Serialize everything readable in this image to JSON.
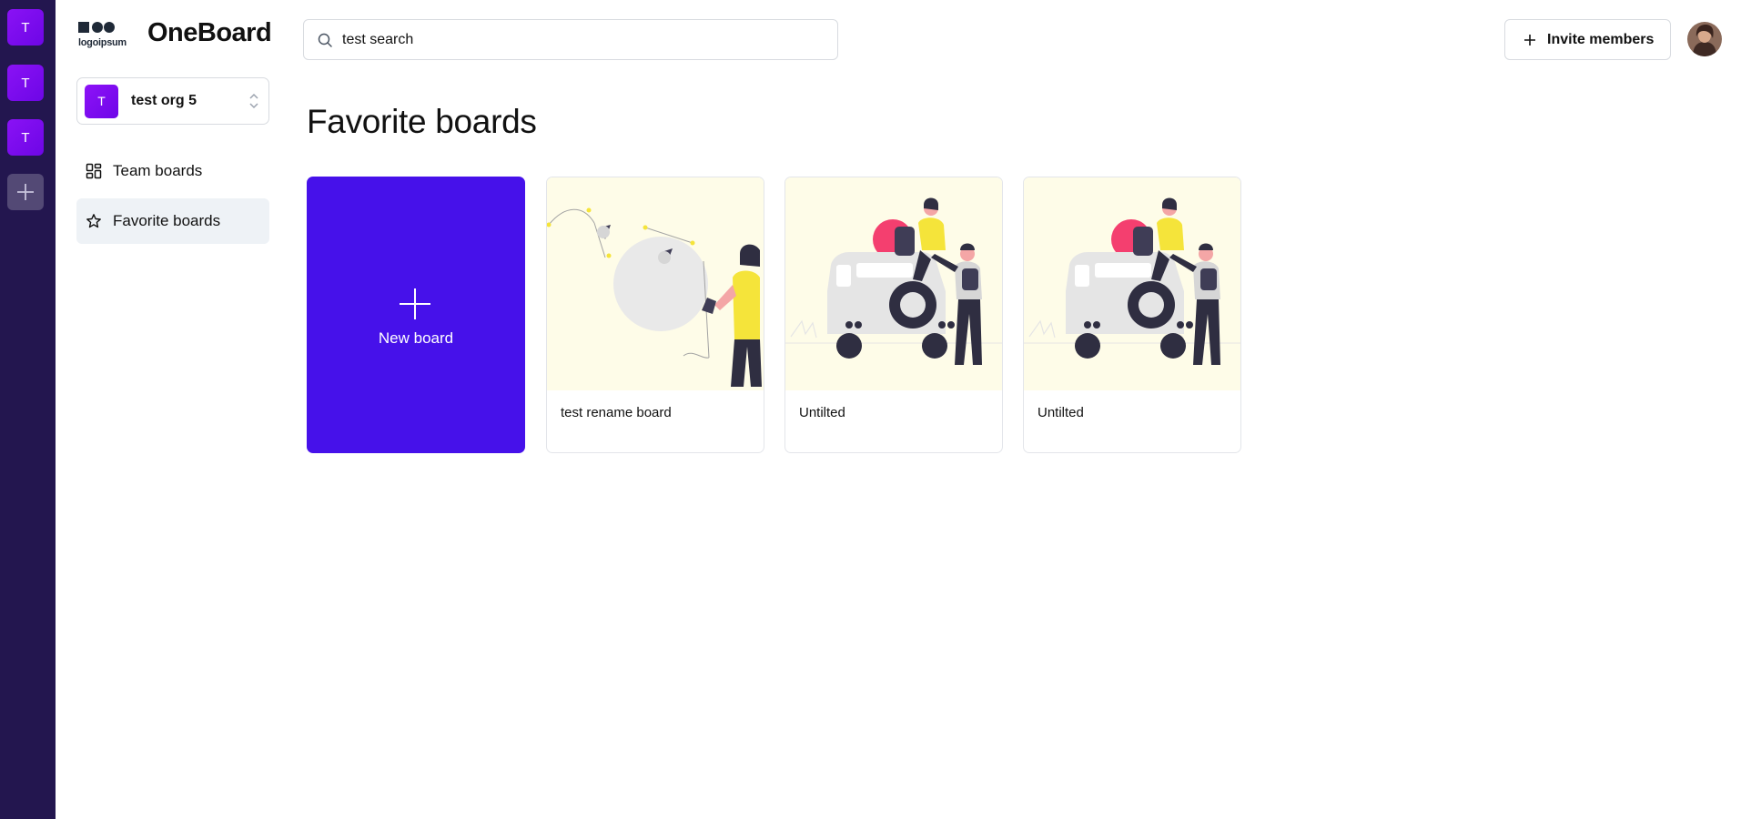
{
  "rail": {
    "orgs": [
      {
        "initial": "T"
      },
      {
        "initial": "T"
      },
      {
        "initial": "T"
      }
    ]
  },
  "brand": {
    "logo_text": "logoipsum",
    "app_name": "OneBoard"
  },
  "org_switcher": {
    "initial": "T",
    "name": "test org 5"
  },
  "nav": {
    "items": [
      {
        "label": "Team boards",
        "icon": "dashboard-icon",
        "active": false
      },
      {
        "label": "Favorite boards",
        "icon": "star-icon",
        "active": true
      }
    ]
  },
  "search": {
    "value": "test search",
    "icon": "search-icon"
  },
  "header": {
    "invite_label": "Invite members"
  },
  "main": {
    "title": "Favorite boards",
    "new_board_label": "New board",
    "boards": [
      {
        "title": "test rename board",
        "illustration": "person-with-balloon"
      },
      {
        "title": "Untilted",
        "illustration": "people-with-car"
      },
      {
        "title": "Untilted",
        "illustration": "people-with-car"
      }
    ]
  },
  "colors": {
    "rail_bg": "#23164f",
    "accent": "#4611ea",
    "org_purple": "#7b0cf0",
    "thumb_bg": "#fefce8"
  }
}
